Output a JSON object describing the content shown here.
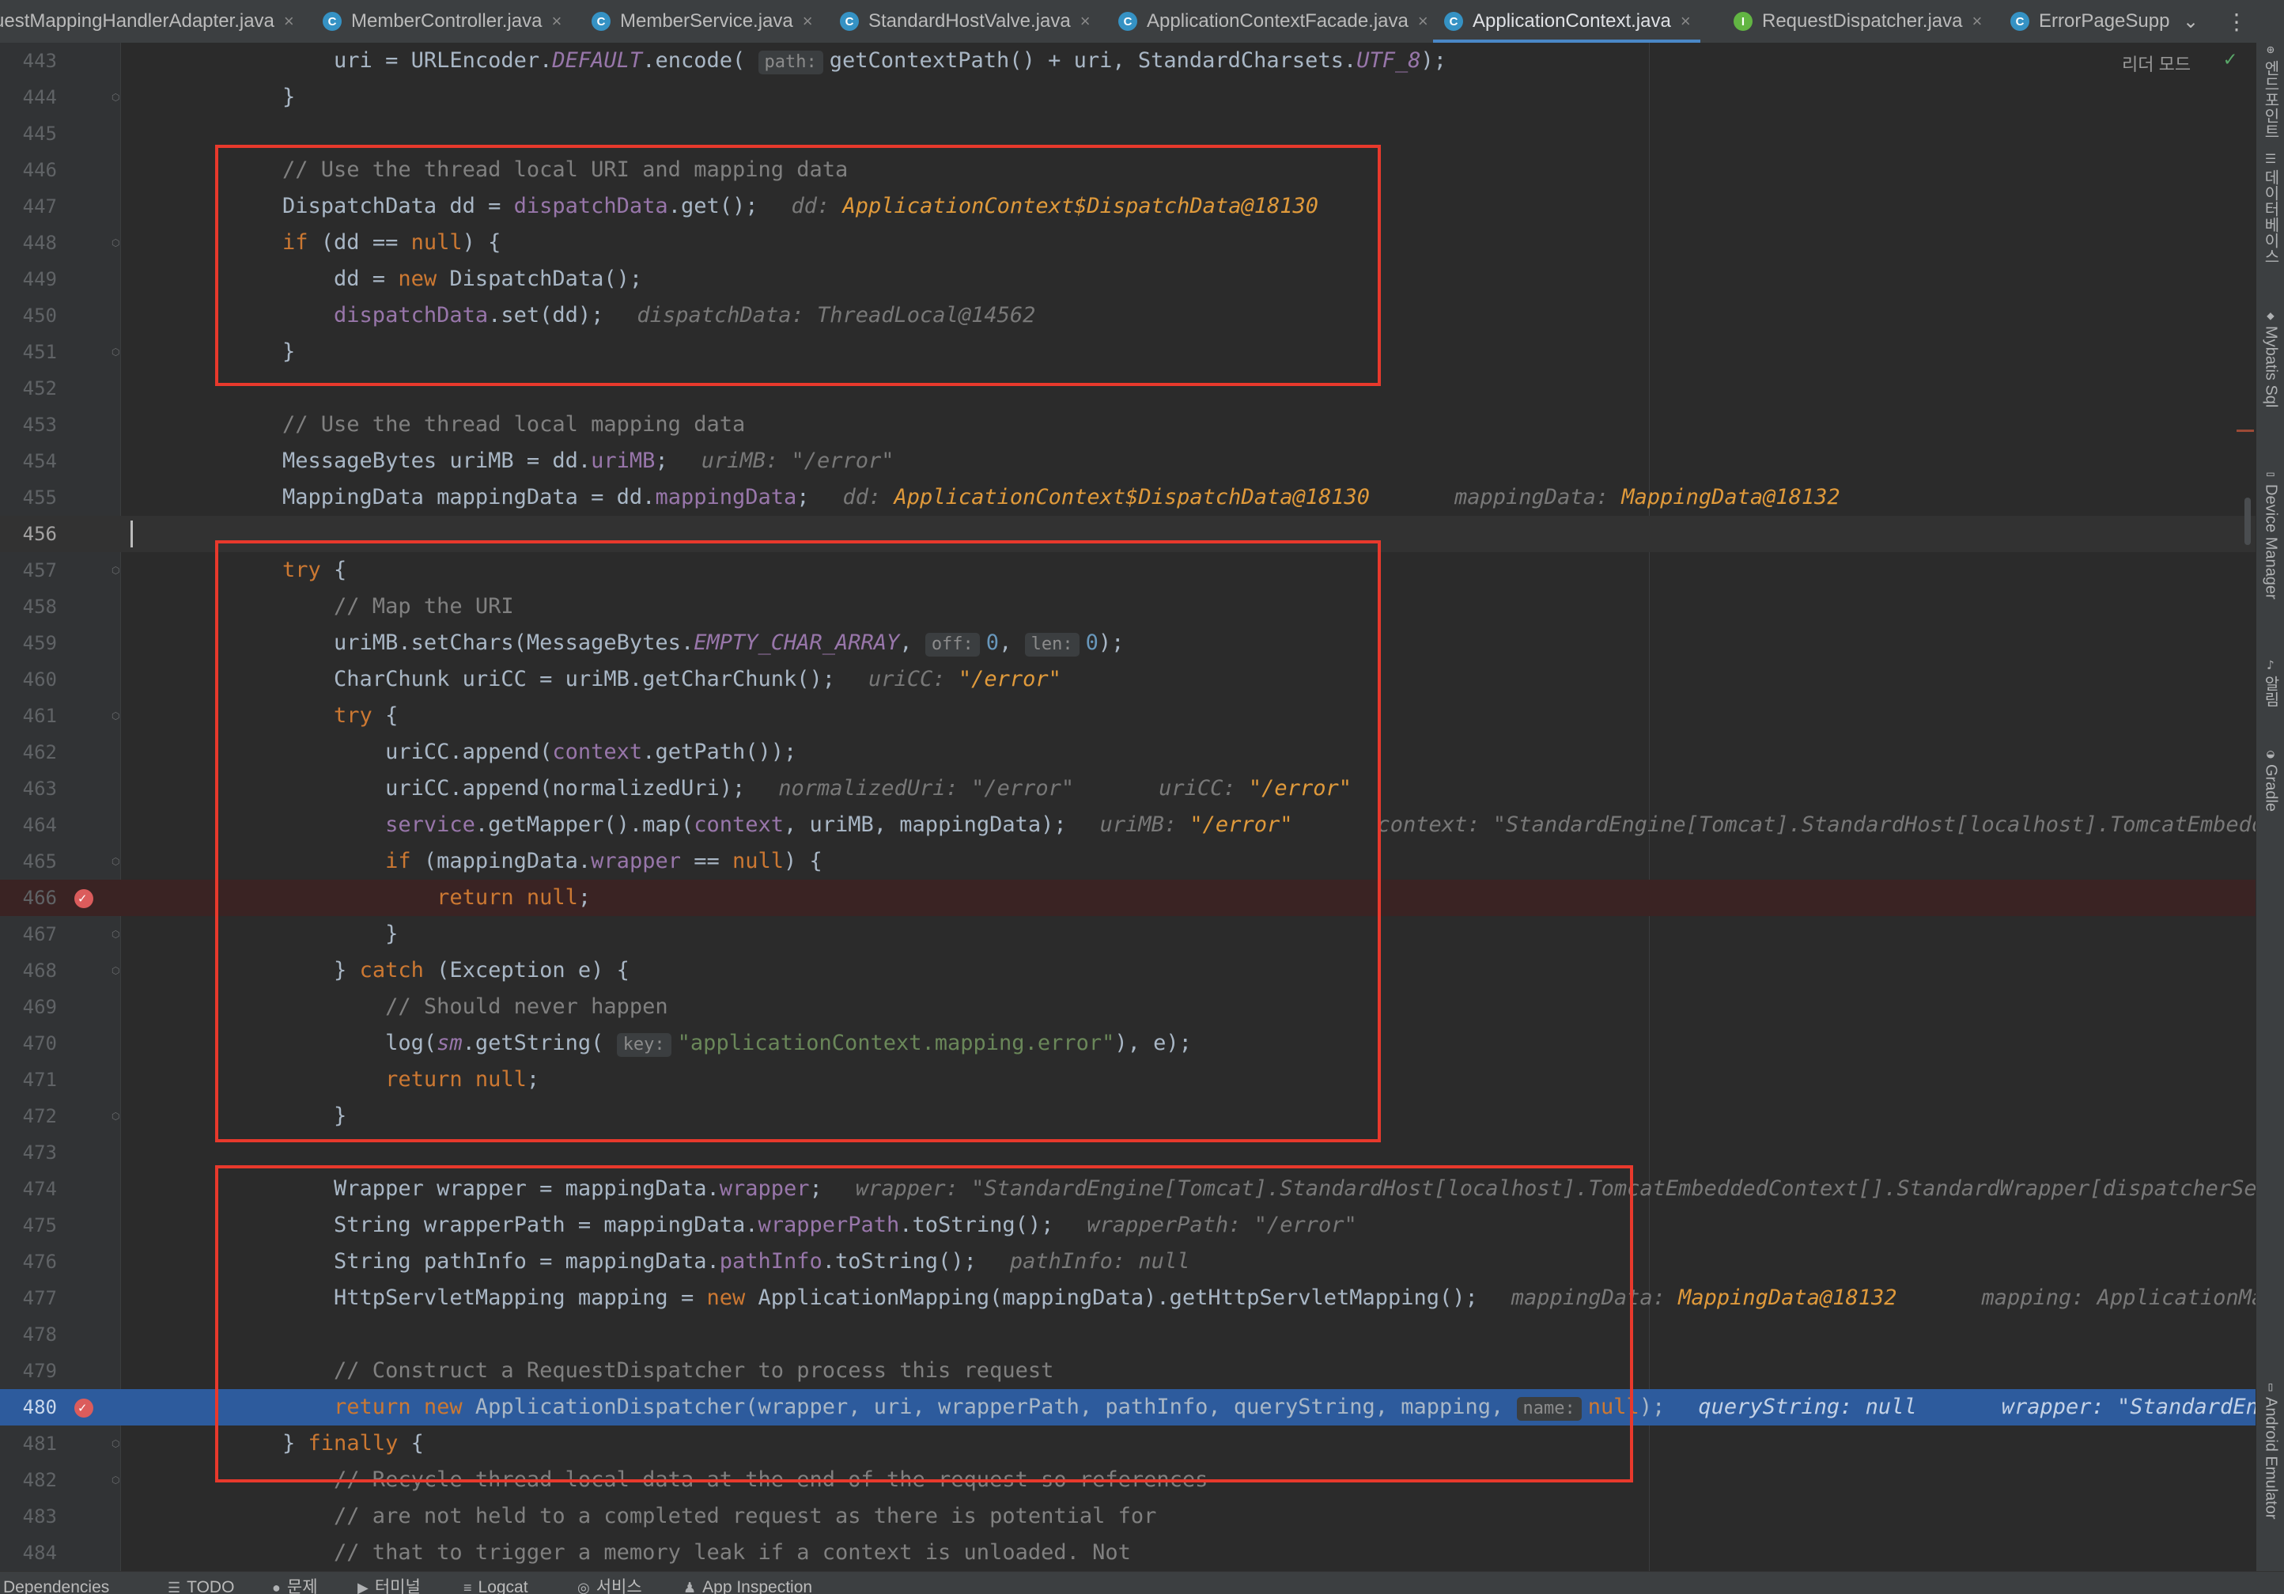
{
  "tabs": [
    {
      "label": "uestMappingHandlerAdapter.java",
      "kind": "class",
      "active": false
    },
    {
      "label": "MemberController.java",
      "kind": "class",
      "active": false
    },
    {
      "label": "MemberService.java",
      "kind": "class",
      "active": false
    },
    {
      "label": "StandardHostValve.java",
      "kind": "class",
      "active": false
    },
    {
      "label": "ApplicationContextFacade.java",
      "kind": "class",
      "active": false
    },
    {
      "label": "ApplicationContext.java",
      "kind": "class",
      "active": true
    },
    {
      "label": "RequestDispatcher.java",
      "kind": "interface",
      "active": false
    },
    {
      "label": "ErrorPageSupp",
      "kind": "class",
      "active": false
    }
  ],
  "editor": {
    "reader_mode": "리더 모드",
    "current_line": 456,
    "execution_line": 480,
    "breakpoint_lines": [
      466,
      480
    ],
    "lines": [
      {
        "n": 443,
        "s": [
          [
            "",
            "        uri = URLEncoder."
          ],
          [
            "st",
            "DEFAULT"
          ],
          [
            "",
            ".encode( "
          ],
          [
            "hint",
            "path:"
          ],
          [
            "",
            "getContextPath() + uri, StandardCharsets."
          ],
          [
            "st",
            "UTF_8"
          ],
          [
            "",
            ");"
          ]
        ]
      },
      {
        "n": 444,
        "s": [
          [
            "",
            "    }"
          ]
        ]
      },
      {
        "n": 445,
        "s": []
      },
      {
        "n": 446,
        "s": [
          [
            "cm",
            "    // Use the thread local URI and mapping data"
          ]
        ]
      },
      {
        "n": 447,
        "s": [
          [
            "",
            "    DispatchData dd = "
          ],
          [
            "fld",
            "dispatchData"
          ],
          [
            "",
            ".get();"
          ],
          [
            "dbgk",
            "dd: "
          ],
          [
            "dbgo",
            "ApplicationContext$DispatchData@18130"
          ]
        ]
      },
      {
        "n": 448,
        "s": [
          [
            "kw",
            "    if "
          ],
          [
            "",
            "(dd == "
          ],
          [
            "kw",
            "null"
          ],
          [
            "",
            ") {"
          ]
        ]
      },
      {
        "n": 449,
        "s": [
          [
            "",
            "        dd = "
          ],
          [
            "kw",
            "new "
          ],
          [
            "",
            "DispatchData();"
          ]
        ]
      },
      {
        "n": 450,
        "s": [
          [
            "fld",
            "        dispatchData"
          ],
          [
            "",
            ".set(dd);"
          ],
          [
            "dbgk",
            "dispatchData: "
          ],
          [
            "dbgv",
            "ThreadLocal@14562"
          ]
        ]
      },
      {
        "n": 451,
        "s": [
          [
            "",
            "    }"
          ]
        ]
      },
      {
        "n": 452,
        "s": []
      },
      {
        "n": 453,
        "s": [
          [
            "cm",
            "    // Use the thread local mapping data"
          ]
        ]
      },
      {
        "n": 454,
        "s": [
          [
            "",
            "    MessageBytes uriMB = dd."
          ],
          [
            "fld",
            "uriMB"
          ],
          [
            "",
            ";"
          ],
          [
            "dbgk",
            "uriMB: "
          ],
          [
            "dbgv",
            "\"/error\""
          ]
        ]
      },
      {
        "n": 455,
        "s": [
          [
            "",
            "    MappingData mappingData = dd."
          ],
          [
            "fld",
            "mappingData"
          ],
          [
            "",
            ";"
          ],
          [
            "dbgk",
            "dd: "
          ],
          [
            "dbgo",
            "ApplicationContext$DispatchData@18130"
          ],
          [
            "dbgk",
            "    mappingData: "
          ],
          [
            "dbgo",
            "MappingData@18132"
          ]
        ]
      },
      {
        "n": 456,
        "s": []
      },
      {
        "n": 457,
        "s": [
          [
            "kw",
            "    try "
          ],
          [
            "",
            "{"
          ]
        ]
      },
      {
        "n": 458,
        "s": [
          [
            "cm",
            "        // Map the URI"
          ]
        ]
      },
      {
        "n": 459,
        "s": [
          [
            "",
            "        uriMB.setChars(MessageBytes."
          ],
          [
            "st",
            "EMPTY_CHAR_ARRAY"
          ],
          [
            "",
            ", "
          ],
          [
            "hint",
            "off:"
          ],
          [
            "num",
            "0"
          ],
          [
            "",
            ", "
          ],
          [
            "hint",
            "len:"
          ],
          [
            "num",
            "0"
          ],
          [
            "",
            ");"
          ]
        ]
      },
      {
        "n": 460,
        "s": [
          [
            "",
            "        CharChunk uriCC = uriMB.getCharChunk();"
          ],
          [
            "dbgk",
            "uriCC: "
          ],
          [
            "dbgo",
            "\"/error\""
          ]
        ]
      },
      {
        "n": 461,
        "s": [
          [
            "kw",
            "        try "
          ],
          [
            "",
            "{"
          ]
        ]
      },
      {
        "n": 462,
        "s": [
          [
            "",
            "            uriCC.append("
          ],
          [
            "fld",
            "context"
          ],
          [
            "",
            ".getPath());"
          ]
        ]
      },
      {
        "n": 463,
        "s": [
          [
            "",
            "            uriCC.append(normalizedUri);"
          ],
          [
            "dbgk",
            "normalizedUri: "
          ],
          [
            "dbgv",
            "\"/error\""
          ],
          [
            "dbgk",
            "    uriCC: "
          ],
          [
            "dbgo",
            "\"/error\""
          ]
        ]
      },
      {
        "n": 464,
        "s": [
          [
            "fld",
            "            service"
          ],
          [
            "",
            ".getMapper().map("
          ],
          [
            "fld",
            "context"
          ],
          [
            "",
            ", uriMB, mappingData);"
          ],
          [
            "dbgk",
            "uriMB: "
          ],
          [
            "dbgo",
            "\"/error\""
          ],
          [
            "dbgk",
            "    context: "
          ],
          [
            "dbgv",
            "\"StandardEngine[Tomcat].StandardHost[localhost].TomcatEmbeddedContex"
          ]
        ]
      },
      {
        "n": 465,
        "s": [
          [
            "kw",
            "            if "
          ],
          [
            "",
            "(mappingData."
          ],
          [
            "fld",
            "wrapper"
          ],
          [
            "",
            " == "
          ],
          [
            "kw",
            "null"
          ],
          [
            "",
            ") {"
          ]
        ]
      },
      {
        "n": 466,
        "s": [
          [
            "kw",
            "                return null"
          ],
          [
            "",
            ";"
          ]
        ]
      },
      {
        "n": 467,
        "s": [
          [
            "",
            "            }"
          ]
        ]
      },
      {
        "n": 468,
        "s": [
          [
            "",
            "        } "
          ],
          [
            "kw",
            "catch "
          ],
          [
            "",
            "(Exception e) {"
          ]
        ]
      },
      {
        "n": 469,
        "s": [
          [
            "cm",
            "            // Should never happen"
          ]
        ]
      },
      {
        "n": 470,
        "s": [
          [
            "",
            "            log("
          ],
          [
            "st",
            "sm"
          ],
          [
            "",
            ".getString( "
          ],
          [
            "hint",
            "key:"
          ],
          [
            "str",
            "\"applicationContext.mapping.error\""
          ],
          [
            "",
            "), e);"
          ]
        ]
      },
      {
        "n": 471,
        "s": [
          [
            "kw",
            "            return null"
          ],
          [
            "",
            ";"
          ]
        ]
      },
      {
        "n": 472,
        "s": [
          [
            "",
            "        }"
          ]
        ]
      },
      {
        "n": 473,
        "s": []
      },
      {
        "n": 474,
        "s": [
          [
            "",
            "        Wrapper wrapper = mappingData."
          ],
          [
            "fld",
            "wrapper"
          ],
          [
            "",
            ";"
          ],
          [
            "dbgk",
            "wrapper: "
          ],
          [
            "dbgv",
            "\"StandardEngine[Tomcat].StandardHost[localhost].TomcatEmbeddedContext[].StandardWrapper[dispatcherServlet]"
          ]
        ]
      },
      {
        "n": 475,
        "s": [
          [
            "",
            "        String wrapperPath = mappingData."
          ],
          [
            "fld",
            "wrapperPath"
          ],
          [
            "",
            ".toString();"
          ],
          [
            "dbgk",
            "wrapperPath: "
          ],
          [
            "dbgv",
            "\"/error\""
          ]
        ]
      },
      {
        "n": 476,
        "s": [
          [
            "",
            "        String pathInfo = mappingData."
          ],
          [
            "fld",
            "pathInfo"
          ],
          [
            "",
            ".toString();"
          ],
          [
            "dbgk",
            "pathInfo: "
          ],
          [
            "dbgv",
            "null"
          ]
        ]
      },
      {
        "n": 477,
        "s": [
          [
            "",
            "        HttpServletMapping mapping = "
          ],
          [
            "kw",
            "new "
          ],
          [
            "",
            "ApplicationMapping(mappingData).getHttpServletMapping();"
          ],
          [
            "dbgk",
            "mappingData: "
          ],
          [
            "dbgo",
            "MappingData@18132"
          ],
          [
            "dbgk",
            "    mapping: "
          ],
          [
            "dbgv",
            "ApplicationMapping$Ma"
          ]
        ]
      },
      {
        "n": 478,
        "s": []
      },
      {
        "n": 479,
        "s": [
          [
            "cm",
            "        // Construct a RequestDispatcher to process this request"
          ]
        ]
      },
      {
        "n": 480,
        "s": [
          [
            "kw",
            "        return new "
          ],
          [
            "",
            "ApplicationDispatcher(wrapper, uri, wrapperPath, pathInfo, queryString, mapping, "
          ],
          [
            "hint",
            "name:"
          ],
          [
            "kw",
            "null"
          ],
          [
            "",
            ");"
          ],
          [
            "dbgk",
            "queryString: "
          ],
          [
            "dbgv",
            "null"
          ],
          [
            "dbgk",
            "    wrapper: "
          ],
          [
            "dbgv",
            "\"StandardEngine[Tom"
          ]
        ]
      },
      {
        "n": 481,
        "s": [
          [
            "",
            "    } "
          ],
          [
            "kw",
            "finally "
          ],
          [
            "",
            "{"
          ]
        ]
      },
      {
        "n": 482,
        "s": [
          [
            "cm",
            "        // Recycle thread local data at the end of the request so references"
          ]
        ]
      },
      {
        "n": 483,
        "s": [
          [
            "cm",
            "        // are not held to a completed request as there is potential for"
          ]
        ]
      },
      {
        "n": 484,
        "s": [
          [
            "cm",
            "        // that to trigger a memory leak if a context is unloaded. Not"
          ]
        ]
      }
    ]
  },
  "right_tools": [
    {
      "label": "엔드포인트",
      "icon": "endpoints-icon"
    },
    {
      "label": "데이터베이스",
      "icon": "database-icon"
    },
    {
      "label": "Mybatis Sql",
      "icon": "mybatis-icon"
    },
    {
      "label": "Device Manager",
      "icon": "device-manager-icon"
    },
    {
      "label": "알림",
      "icon": "notifications-icon"
    },
    {
      "label": "Gradle",
      "icon": "gradle-icon"
    },
    {
      "label": "Android Emulator",
      "icon": "emulator-icon"
    }
  ],
  "bottom_tools": [
    {
      "label": "Dependencies",
      "icon": "dependencies-icon"
    },
    {
      "label": "TODO",
      "icon": "todo-icon"
    },
    {
      "label": "문제",
      "icon": "problems-icon"
    },
    {
      "label": "터미널",
      "icon": "terminal-icon"
    },
    {
      "label": "Logcat",
      "icon": "logcat-icon"
    },
    {
      "label": "서비스",
      "icon": "services-icon"
    },
    {
      "label": "App Inspection",
      "icon": "app-inspection-icon"
    }
  ],
  "colors": {
    "editor_bg": "#2b2b2b",
    "gutter_bg": "#313335",
    "keyword": "#cc7832",
    "comment": "#808080",
    "field": "#9876aa",
    "debug_value": "#e09a3b",
    "execution_line": "#2d5b9d",
    "breakpoint": "#db5c5c",
    "highlight_box": "#e8392c"
  }
}
